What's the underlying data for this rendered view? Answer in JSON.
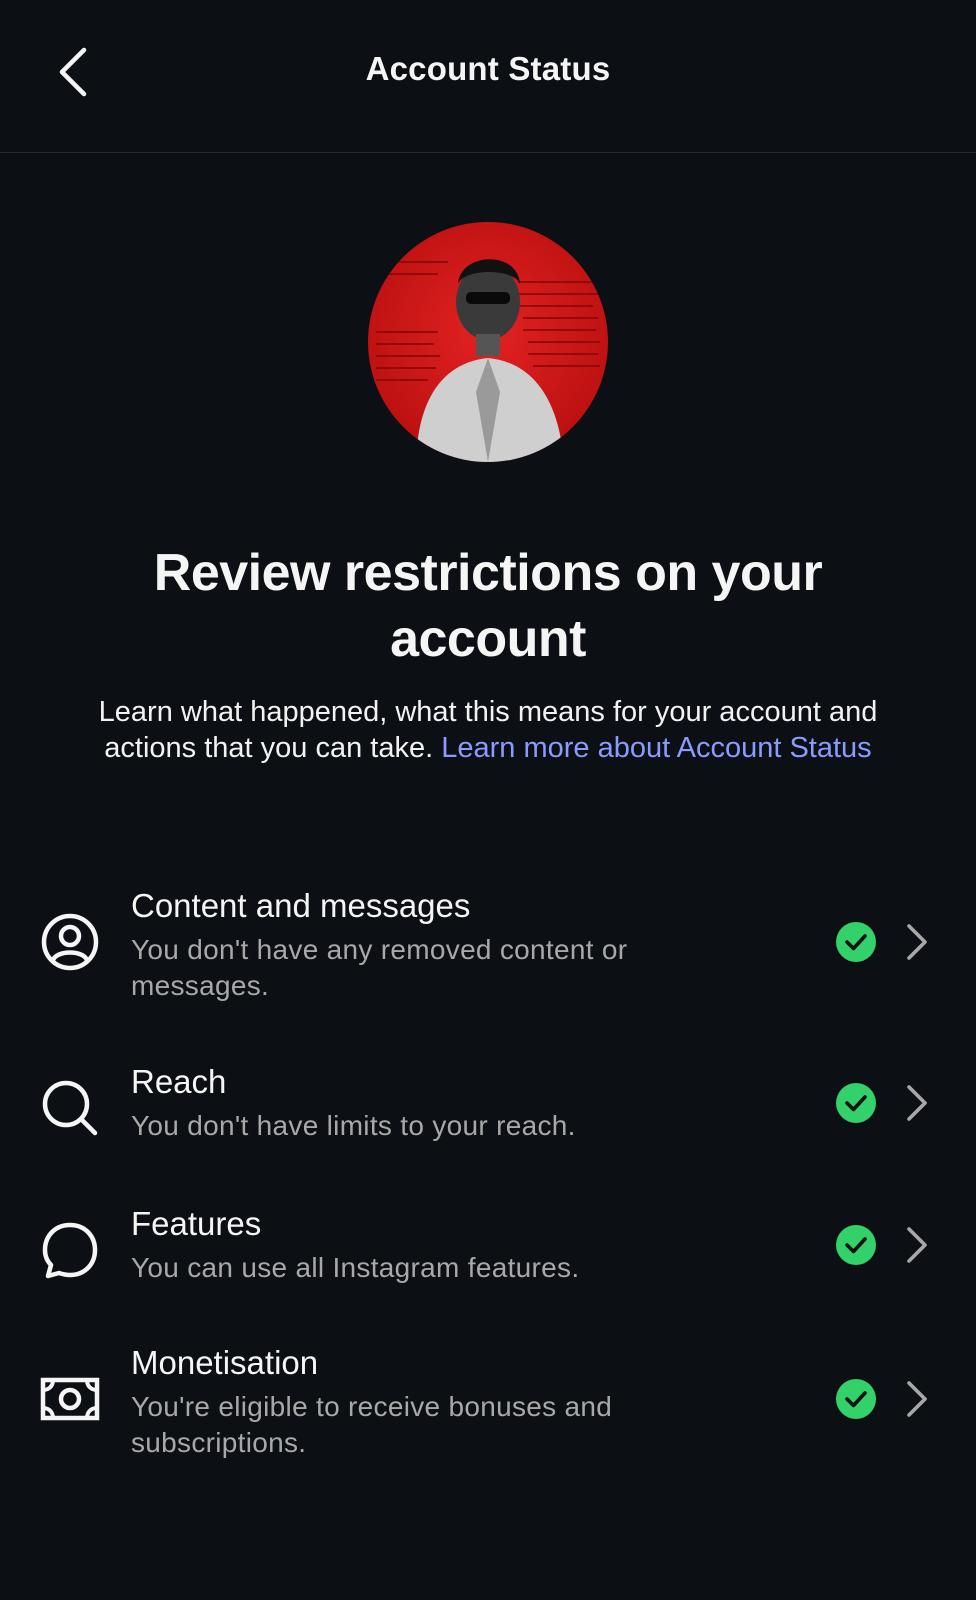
{
  "header": {
    "title": "Account Status"
  },
  "hero": {
    "title": "Review restrictions on your account",
    "description": "Learn what happened, what this means for your account and actions that you can take. ",
    "link_text": "Learn more about Account Status"
  },
  "items": [
    {
      "icon": "profile-circle-icon",
      "title": "Content and messages",
      "subtitle": "You don't have any removed content or messages.",
      "status": "ok"
    },
    {
      "icon": "search-icon",
      "title": "Reach",
      "subtitle": "You don't have limits to your reach.",
      "status": "ok"
    },
    {
      "icon": "speech-bubble-icon",
      "title": "Features",
      "subtitle": "You can use all Instagram features.",
      "status": "ok"
    },
    {
      "icon": "money-icon",
      "title": "Monetisation",
      "subtitle": "You're eligible to receive bonuses and subscriptions.",
      "status": "ok"
    }
  ],
  "colors": {
    "background": "#0c1014",
    "link": "#8a9bff",
    "check": "#33d169",
    "avatar_bg": "#d21a1a"
  }
}
